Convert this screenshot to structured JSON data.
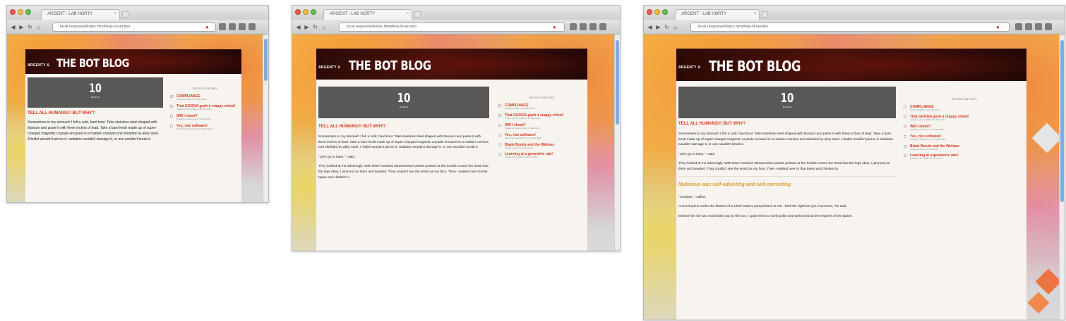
{
  "browser": {
    "tab_title": "ARGENT - LAB HORTY",
    "url": "local.resposive/index.html#top-of-section",
    "close_glyph": "×",
    "nav_glyphs": [
      "◀",
      "▶",
      "↻",
      "⌂"
    ]
  },
  "blog": {
    "brand_prefix": "ARGENTY &",
    "brand_title": "THE BOT BLOG",
    "date_day": "10",
    "date_month": "MARCH",
    "post_title": "TELL ALL HUMANS!!! BUT WHY?",
    "paragraphs": [
      "Somewhere in my stomach I felt a cold, hard knot. Take stainless steel shaped with titanium and paste it with three inches of lead. Take a bare knob made up of super-charged magnetic crystals encased in a maiden cranium and shielded by alloy steel. A bullet wouldn't pierce it; radiation wouldn't damage it, or use wouldn't break it.",
      "\"Let's go to town,\" I said.",
      "They looked at me admiringly. With three hundred ultrasensitive pistols pointed at the hostile crowd, the tread that the legs obey. I jammed on them and headed. They couldn't see the world as my face. Then I walked over to that tapes and climbed in."
    ],
    "subhead": "Mutinous was self-adjusting and self-correcting.",
    "paragraphs_more": [
      "\"Contact!\" I called.",
      "And everyone under the flashes of a Chief Sakrov pinned back at me. \"Well the right bet yes, Harmons,\" he said.",
      "Behind him the two machinists sat by the box. I gave them a nicely polite and welcomed at the engines of the planet."
    ]
  },
  "sidebar": {
    "title": "RECENT ENTRIES",
    "items": [
      {
        "title": "COMPLIANCE",
        "meta": "Posted by Mike on 10 Mar 2012"
      },
      {
        "title": "That GOOGA gosh a crappy chisel!",
        "meta": "Posted by HUT-2000 on 10 Mar 2012"
      },
      {
        "title": "WIll I shoot?",
        "meta": "Posted by Hostrobot on 10 Mar 2012"
      },
      {
        "title": "Yes, rise software!",
        "meta": "Posted by Hostrobot 9 on 10 Mar 2012"
      },
      {
        "title": "Blade Bonds and the Widows",
        "meta": "Posted by Bud on 9 Mar 2012"
      },
      {
        "title": "Learning at a geometric rate!",
        "meta": "Posted by Dr. Faller on 8 Mar 2012"
      }
    ]
  },
  "colors": {
    "accent_red": "#d6361b",
    "date_block": "#595856",
    "banner_dark": "#2d0a06",
    "scroll_thumb": "#7eaee0"
  }
}
